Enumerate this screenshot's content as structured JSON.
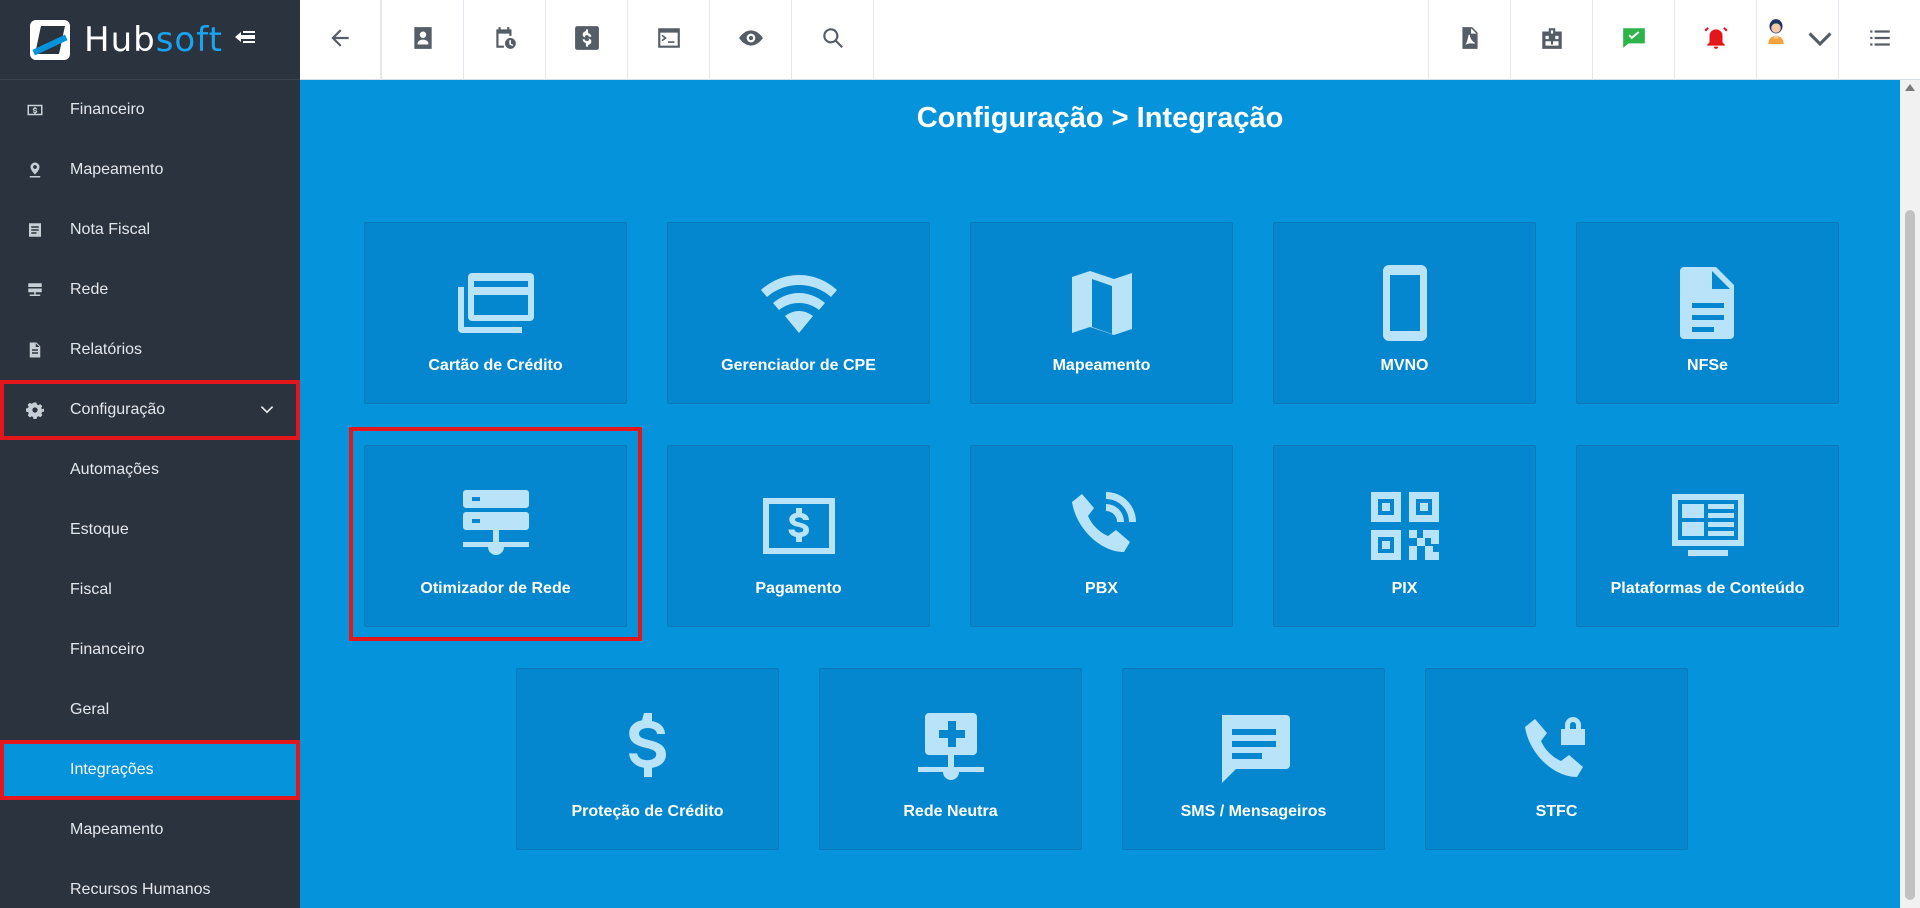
{
  "brand": {
    "name_part1": "Hub",
    "name_part2": "soft"
  },
  "sidebar": {
    "items": [
      {
        "label": "Financeiro",
        "icon": "money-icon"
      },
      {
        "label": "Mapeamento",
        "icon": "map-pin-icon"
      },
      {
        "label": "Nota Fiscal",
        "icon": "receipt-icon"
      },
      {
        "label": "Rede",
        "icon": "network-icon"
      },
      {
        "label": "Relatórios",
        "icon": "report-icon"
      },
      {
        "label": "Configuração",
        "icon": "gear-icon",
        "expanded": true
      }
    ],
    "subitems": [
      {
        "label": "Automações"
      },
      {
        "label": "Estoque"
      },
      {
        "label": "Fiscal"
      },
      {
        "label": "Financeiro"
      },
      {
        "label": "Geral"
      },
      {
        "label": "Integrações",
        "active": true
      },
      {
        "label": "Mapeamento"
      },
      {
        "label": "Recursos Humanos"
      }
    ]
  },
  "topbar": {
    "left_icons": [
      "back-arrow-icon",
      "contact-card-icon",
      "calendar-clock-icon",
      "dollar-icon",
      "terminal-icon",
      "eye-icon",
      "search-icon"
    ],
    "right_icons": [
      "pdf-icon",
      "building-icon",
      "chat-check-icon",
      "alarm-icon",
      "avatar",
      "menu-list-icon"
    ],
    "chat_color": "#2db34a",
    "alarm_color": "#e3161b"
  },
  "main": {
    "title": "Configuração > Integração",
    "tiles": [
      {
        "label": "Cartão de Crédito",
        "icon": "credit-card-icon"
      },
      {
        "label": "Gerenciador de CPE",
        "icon": "wifi-icon"
      },
      {
        "label": "Mapeamento",
        "icon": "map-icon"
      },
      {
        "label": "MVNO",
        "icon": "smartphone-icon"
      },
      {
        "label": "NFSe",
        "icon": "document-icon"
      },
      {
        "label": "Otimizador de Rede",
        "icon": "server-network-icon",
        "highlighted": true
      },
      {
        "label": "Pagamento",
        "icon": "payment-icon"
      },
      {
        "label": "PBX",
        "icon": "phone-ring-icon"
      },
      {
        "label": "PIX",
        "icon": "qr-code-icon"
      },
      {
        "label": "Plataformas de Conteúdo",
        "icon": "dashboard-screen-icon"
      },
      {
        "label": "Proteção de Crédito",
        "icon": "dollar-sign-icon"
      },
      {
        "label": "Rede Neutra",
        "icon": "network-add-icon"
      },
      {
        "label": "SMS / Mensageiros",
        "icon": "message-icon"
      },
      {
        "label": "STFC",
        "icon": "phone-lock-icon"
      }
    ]
  },
  "colors": {
    "accent": "#0594dc",
    "tile": "#0487cf",
    "sidebar": "#2b333f",
    "highlight": "#e3161b"
  }
}
